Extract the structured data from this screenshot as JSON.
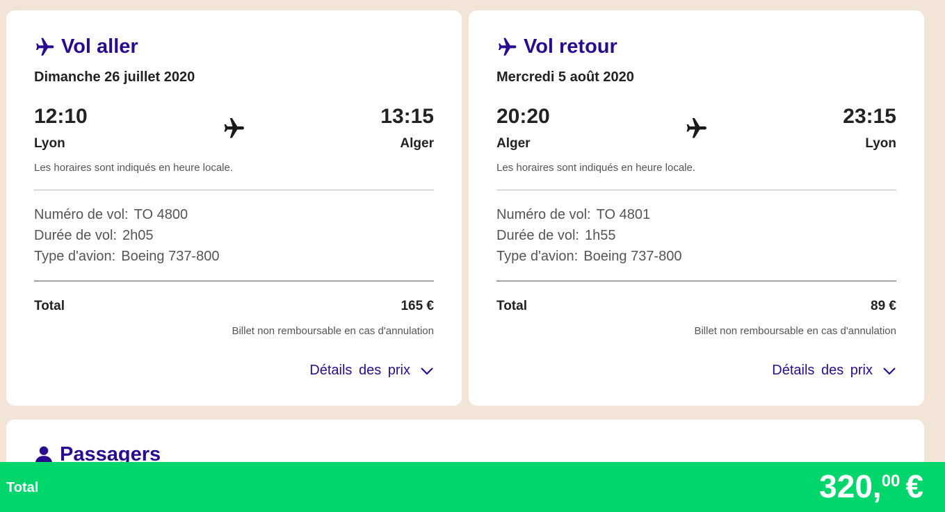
{
  "colors": {
    "accent": "#2a0b8f",
    "background": "#f3e4d8",
    "footer": "#00d66b"
  },
  "outbound": {
    "title": "Vol aller",
    "date": "Dimanche 26 juillet 2020",
    "dep_time": "12:10",
    "arr_time": "13:15",
    "dep_city": "Lyon",
    "arr_city": "Alger",
    "note": "Les horaires sont indiqués en heure locale.",
    "flight_label": "Numéro de vol:",
    "flight_value": "TO 4800",
    "duration_label": "Durée de vol:",
    "duration_value": "2h05",
    "aircraft_label": "Type d'avion:",
    "aircraft_value": "Boeing 737-800",
    "total_label": "Total",
    "total_value": "165 €",
    "refund": "Billet non remboursable en cas d'annulation",
    "details": "Détails des prix"
  },
  "return": {
    "title": "Vol retour",
    "date": "Mercredi 5 août 2020",
    "dep_time": "20:20",
    "arr_time": "23:15",
    "dep_city": "Alger",
    "arr_city": "Lyon",
    "note": "Les horaires sont indiqués en heure locale.",
    "flight_label": "Numéro de vol:",
    "flight_value": "TO 4801",
    "duration_label": "Durée de vol:",
    "duration_value": "1h55",
    "aircraft_label": "Type d'avion:",
    "aircraft_value": "Boeing 737-800",
    "total_label": "Total",
    "total_value": "89 €",
    "refund": "Billet non remboursable en cas d'annulation",
    "details": "Détails des prix"
  },
  "passengers": {
    "title": "Passagers"
  },
  "footer": {
    "label": "Total",
    "amount_main": "320,",
    "amount_cents": "00",
    "currency": "€"
  },
  "icons": {
    "title_plane": "plane-icon",
    "mid_plane": "plane-icon",
    "chevron": "chevron-down-icon",
    "person": "person-icon"
  }
}
